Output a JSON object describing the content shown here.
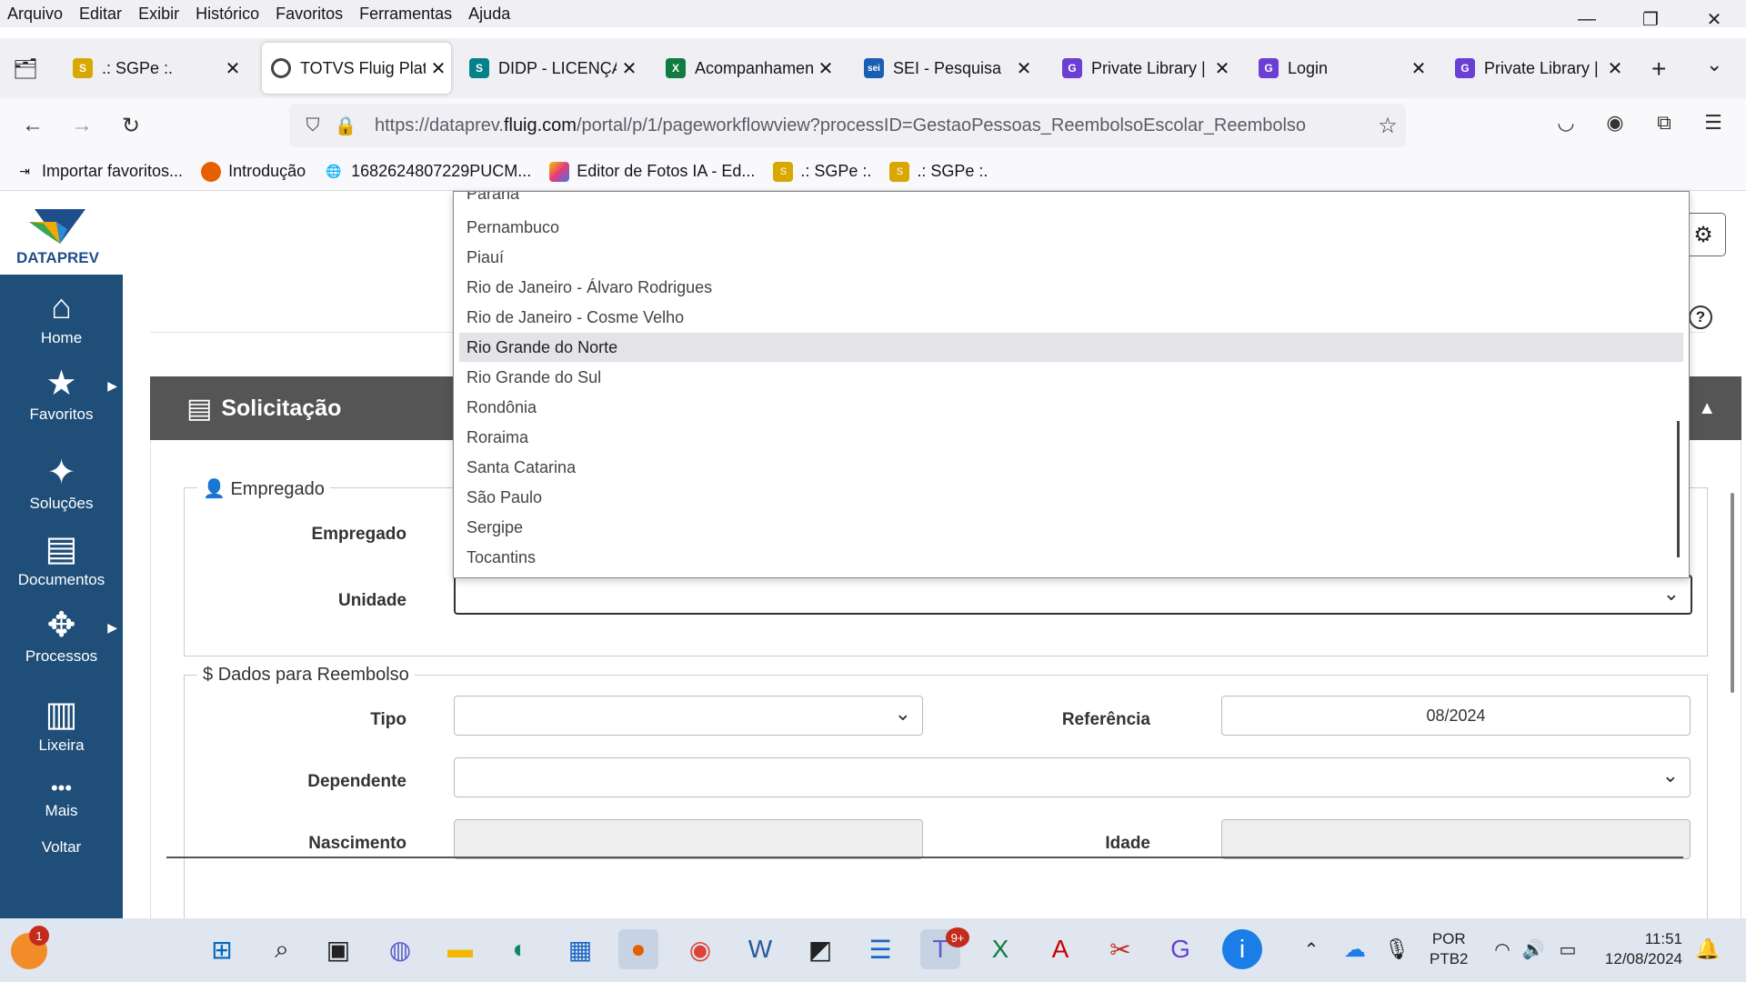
{
  "menubar": {
    "items": [
      "Arquivo",
      "Editar",
      "Exibir",
      "Histórico",
      "Favoritos",
      "Ferramentas",
      "Ajuda"
    ],
    "minimize": "—",
    "restore": "❐",
    "close": "✕"
  },
  "tabs": [
    {
      "title": ".: SGPe :.",
      "close": "✕"
    },
    {
      "title": "TOTVS Fluig Plataforma",
      "close": "✕"
    },
    {
      "title": "DIDP - LICENÇA",
      "close": "✕"
    },
    {
      "title": "Acompanhamento",
      "close": "✕"
    },
    {
      "title": "SEI - Pesquisa",
      "close": "✕"
    },
    {
      "title": "Private Library | G",
      "close": "✕"
    },
    {
      "title": "Login",
      "close": "✕"
    },
    {
      "title": "Private Library | G",
      "close": "✕"
    }
  ],
  "tab_new": "+",
  "tab_overflow": "⌄",
  "nav": {
    "back": "←",
    "forward": "→",
    "reload": "↻",
    "url_prefix": "https://dataprev.",
    "url_host": "fluig.com",
    "url_rest": "/portal/p/1/pageworkflowview?processID=GestaoPessoas_ReembolsoEscolar_Reembolso",
    "star": "☆"
  },
  "bookmarks": [
    {
      "label": "Importar favoritos..."
    },
    {
      "label": "Introdução"
    },
    {
      "label": "1682624807229PUCM..."
    },
    {
      "label": "Editor de Fotos IA - Ed..."
    },
    {
      "label": ".: SGPe :."
    },
    {
      "label": ".: SGPe :."
    }
  ],
  "app": {
    "logo_text": "DATAPREV",
    "gear": "⚙"
  },
  "sidebar": {
    "items": [
      {
        "label": "Home",
        "icon": "⌂"
      },
      {
        "label": "Favoritos",
        "icon": "★"
      },
      {
        "label": "Soluções",
        "icon": "✦"
      },
      {
        "label": "Documentos",
        "icon": "▤"
      },
      {
        "label": "Processos",
        "icon": "✥"
      },
      {
        "label": "Lixeira",
        "icon": "▥"
      },
      {
        "label": "Mais",
        "icon": "•••"
      },
      {
        "label": "Voltar"
      }
    ],
    "arrow": "▶"
  },
  "panel": {
    "title": "Solicitação",
    "collapse": "▲"
  },
  "help": "?",
  "empregado_section": {
    "legend": "Empregado",
    "empregado_label": "Empregado",
    "unidade_label": "Unidade"
  },
  "reembolso_section": {
    "legend": "Dados para Reembolso",
    "tipo_label": "Tipo",
    "referencia_label": "Referência",
    "referencia_value": "08/2024",
    "dependente_label": "Dependente",
    "nascimento_label": "Nascimento",
    "idade_label": "Idade"
  },
  "chevron": "⌄",
  "dropdown": {
    "options": [
      "Paraná",
      "Pernambuco",
      "Piauí",
      "Rio de Janeiro - Álvaro Rodrigues",
      "Rio de Janeiro - Cosme Velho",
      "Rio Grande do Norte",
      "Rio Grande do Sul",
      "Rondônia",
      "Roraima",
      "Santa Catarina",
      "São Paulo",
      "Sergipe",
      "Tocantins"
    ],
    "highlighted": "Rio Grande do Norte"
  },
  "taskbar": {
    "notification_count": "1",
    "teams_badge": "9+",
    "lang_line1": "POR",
    "lang_line2": "PTB2",
    "time": "11:51",
    "date": "12/08/2024"
  },
  "colors": {
    "sidebar": "#1f4e79",
    "panel_header": "#555555"
  }
}
